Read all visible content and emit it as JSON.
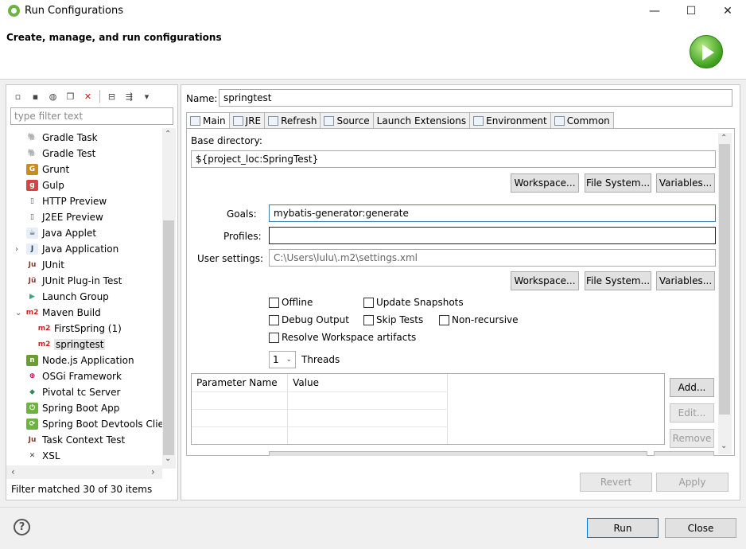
{
  "window": {
    "title": "Run Configurations",
    "minimize": "—",
    "maximize": "☐",
    "close": "✕"
  },
  "banner": {
    "title": "Create, manage, and run configurations"
  },
  "left": {
    "filter_placeholder": "type filter text",
    "toolbar": [
      "new",
      "duplicate-prototype",
      "export",
      "duplicate",
      "delete",
      "collapse-all",
      "filter"
    ],
    "items": [
      {
        "label": "Gradle Task",
        "icon": "gradle-icon",
        "level": 0
      },
      {
        "label": "Gradle Test",
        "icon": "gradle-icon",
        "level": 0
      },
      {
        "label": "Grunt",
        "icon": "grunt-icon",
        "level": 0
      },
      {
        "label": "Gulp",
        "icon": "gulp-icon",
        "level": 0
      },
      {
        "label": "HTTP Preview",
        "icon": "http-preview-icon",
        "level": 0
      },
      {
        "label": "J2EE Preview",
        "icon": "j2ee-preview-icon",
        "level": 0
      },
      {
        "label": "Java Applet",
        "icon": "java-applet-icon",
        "level": 0
      },
      {
        "label": "Java Application",
        "icon": "java-application-icon",
        "level": 0,
        "twisty": "›"
      },
      {
        "label": "JUnit",
        "icon": "junit-icon",
        "level": 0
      },
      {
        "label": "JUnit Plug-in Test",
        "icon": "junit-plugin-icon",
        "level": 0
      },
      {
        "label": "Launch Group",
        "icon": "launch-group-icon",
        "level": 0
      },
      {
        "label": "Maven Build",
        "icon": "maven-icon",
        "level": 0,
        "twisty": "⌄"
      },
      {
        "label": "FirstSpring (1)",
        "icon": "maven-icon",
        "level": 1
      },
      {
        "label": "springtest",
        "icon": "maven-icon",
        "level": 1,
        "selected": true
      },
      {
        "label": "Node.js Application",
        "icon": "nodejs-icon",
        "level": 0
      },
      {
        "label": "OSGi Framework",
        "icon": "osgi-icon",
        "level": 0
      },
      {
        "label": "Pivotal tc Server",
        "icon": "pivotal-icon",
        "level": 0
      },
      {
        "label": "Spring Boot App",
        "icon": "spring-boot-icon",
        "level": 0
      },
      {
        "label": "Spring Boot Devtools Clie",
        "icon": "spring-devtools-icon",
        "level": 0
      },
      {
        "label": "Task Context Test",
        "icon": "task-context-icon",
        "level": 0
      },
      {
        "label": "XSL",
        "icon": "xsl-icon",
        "level": 0
      }
    ],
    "status": "Filter matched 30 of 30 items"
  },
  "right": {
    "name_label": "Name:",
    "name_value": "springtest",
    "tabs": [
      {
        "label": "Main",
        "icon": "main-tab-icon",
        "active": true
      },
      {
        "label": "JRE",
        "icon": "jre-tab-icon"
      },
      {
        "label": "Refresh",
        "icon": "refresh-tab-icon"
      },
      {
        "label": "Source",
        "icon": "source-tab-icon"
      },
      {
        "label": "Launch Extensions",
        "icon": ""
      },
      {
        "label": "Environment",
        "icon": "environment-tab-icon"
      },
      {
        "label": "Common",
        "icon": "common-tab-icon"
      }
    ],
    "base_dir_label": "Base directory:",
    "base_dir_value": "${project_loc:SpringTest}",
    "workspace_btn": "Workspace...",
    "filesystem_btn": "File System...",
    "variables_btn": "Variables...",
    "goals_label": "Goals:",
    "goals_value": "mybatis-generator:generate",
    "profiles_label": "Profiles:",
    "profiles_value": "",
    "user_settings_label": "User settings:",
    "user_settings_value": "C:\\Users\\lulu\\.m2\\settings.xml",
    "checkboxes": {
      "offline": "Offline",
      "update_snapshots": "Update Snapshots",
      "debug_output": "Debug Output",
      "skip_tests": "Skip Tests",
      "non_recursive": "Non-recursive",
      "resolve_workspace": "Resolve Workspace artifacts"
    },
    "threads_value": "1",
    "threads_label": "Threads",
    "params_headers": [
      "Parameter Name",
      "Value"
    ],
    "add_btn": "Add...",
    "edit_btn": "Edit...",
    "remove_btn": "Remove",
    "revert_btn": "Revert",
    "apply_btn": "Apply"
  },
  "footer": {
    "help": "?",
    "run_btn": "Run",
    "close_btn": "Close"
  }
}
